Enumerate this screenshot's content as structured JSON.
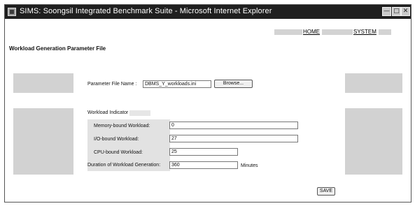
{
  "window": {
    "title": "SIMS: Soongsil Integrated Benchmark Suite - Microsoft Internet Explorer"
  },
  "nav": {
    "home": "HOME",
    "system": "SYSTEM"
  },
  "page": {
    "heading": "Workload Generation Parameter File"
  },
  "parameter_file": {
    "label": "Parameter File Name :",
    "value": "DBMS_Y_workloads.ini",
    "browse": "Browse..."
  },
  "indicator": {
    "title": "Workload Indicator",
    "fields": [
      {
        "label": "Memory-bound Workload:",
        "value": "0"
      },
      {
        "label": "I/O-bound Workload:",
        "value": "27"
      },
      {
        "label": "CPU-bound Workload:",
        "value": "25"
      }
    ],
    "duration": {
      "label": "Duration of Workload Generation:",
      "value": "360",
      "unit": "Minutes"
    }
  },
  "actions": {
    "save": "SAVE"
  }
}
